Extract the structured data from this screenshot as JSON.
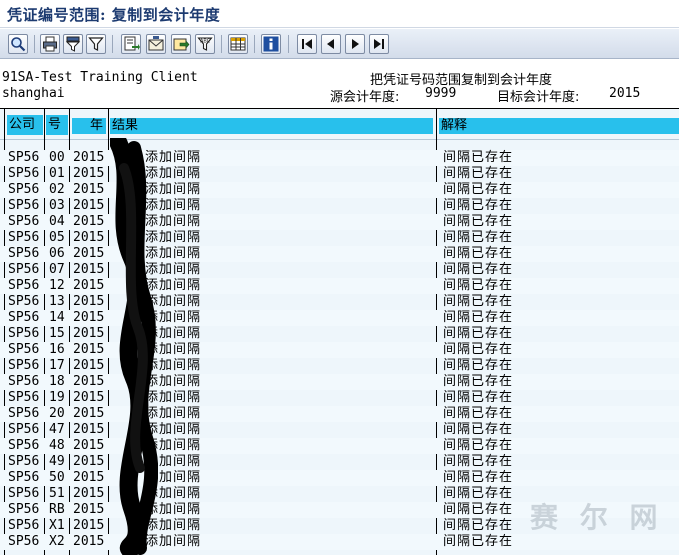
{
  "window": {
    "title": "凭证编号范围: 复制到会计年度"
  },
  "toolbar": {
    "buttons": [
      "search-icon",
      "print-icon",
      "filter-icon",
      "funnel-icon",
      "export-icon",
      "mail-icon",
      "save-icon",
      "abc-filter-icon",
      "table-layout-icon",
      "info-icon",
      "first-page-icon",
      "previous-page-icon",
      "next-page-icon",
      "last-page-icon"
    ]
  },
  "header": {
    "client": "91SA-Test Training Client",
    "city": "shanghai",
    "report_title": "把凭证号码范围复制到会计年度",
    "source_year_label": "源会计年度:",
    "source_year": "9999",
    "target_year_label": "目标会计年度:",
    "target_year": "2015"
  },
  "columns": {
    "company": "公司",
    "number": "号",
    "year": "年",
    "result": "结果",
    "explanation": "解释"
  },
  "rows": [
    {
      "company": "SP56",
      "number": "00",
      "year": "2015",
      "result": "添加间隔",
      "explanation": "间隔已存在"
    },
    {
      "company": "SP56",
      "number": "01",
      "year": "2015",
      "result": "添加间隔",
      "explanation": "间隔已存在"
    },
    {
      "company": "SP56",
      "number": "02",
      "year": "2015",
      "result": "添加间隔",
      "explanation": "间隔已存在"
    },
    {
      "company": "SP56",
      "number": "03",
      "year": "2015",
      "result": "添加间隔",
      "explanation": "间隔已存在"
    },
    {
      "company": "SP56",
      "number": "04",
      "year": "2015",
      "result": "添加间隔",
      "explanation": "间隔已存在"
    },
    {
      "company": "SP56",
      "number": "05",
      "year": "2015",
      "result": "添加间隔",
      "explanation": "间隔已存在"
    },
    {
      "company": "SP56",
      "number": "06",
      "year": "2015",
      "result": "添加间隔",
      "explanation": "间隔已存在"
    },
    {
      "company": "SP56",
      "number": "07",
      "year": "2015",
      "result": "添加间隔",
      "explanation": "间隔已存在"
    },
    {
      "company": "SP56",
      "number": "12",
      "year": "2015",
      "result": "添加间隔",
      "explanation": "间隔已存在"
    },
    {
      "company": "SP56",
      "number": "13",
      "year": "2015",
      "result": "添加间隔",
      "explanation": "间隔已存在"
    },
    {
      "company": "SP56",
      "number": "14",
      "year": "2015",
      "result": "添加间隔",
      "explanation": "间隔已存在"
    },
    {
      "company": "SP56",
      "number": "15",
      "year": "2015",
      "result": "添加间隔",
      "explanation": "间隔已存在"
    },
    {
      "company": "SP56",
      "number": "16",
      "year": "2015",
      "result": "添加间隔",
      "explanation": "间隔已存在"
    },
    {
      "company": "SP56",
      "number": "17",
      "year": "2015",
      "result": "添加间隔",
      "explanation": "间隔已存在"
    },
    {
      "company": "SP56",
      "number": "18",
      "year": "2015",
      "result": "添加间隔",
      "explanation": "间隔已存在"
    },
    {
      "company": "SP56",
      "number": "19",
      "year": "2015",
      "result": "添加间隔",
      "explanation": "间隔已存在"
    },
    {
      "company": "SP56",
      "number": "20",
      "year": "2015",
      "result": "添加间隔",
      "explanation": "间隔已存在"
    },
    {
      "company": "SP56",
      "number": "47",
      "year": "2015",
      "result": "添加间隔",
      "explanation": "间隔已存在"
    },
    {
      "company": "SP56",
      "number": "48",
      "year": "2015",
      "result": "添加间隔",
      "explanation": "间隔已存在"
    },
    {
      "company": "SP56",
      "number": "49",
      "year": "2015",
      "result": "添加间隔",
      "explanation": "间隔已存在"
    },
    {
      "company": "SP56",
      "number": "50",
      "year": "2015",
      "result": "添加间隔",
      "explanation": "间隔已存在"
    },
    {
      "company": "SP56",
      "number": "51",
      "year": "2015",
      "result": "添加间隔",
      "explanation": "间隔已存在"
    },
    {
      "company": "SP56",
      "number": "RB",
      "year": "2015",
      "result": "添加间隔",
      "explanation": "间隔已存在"
    },
    {
      "company": "SP56",
      "number": "X1",
      "year": "2015",
      "result": "添加间隔",
      "explanation": "间隔已存在"
    },
    {
      "company": "SP56",
      "number": "X2",
      "year": "2015",
      "result": "添加间隔",
      "explanation": "间隔已存在"
    }
  ],
  "watermark": "赛 尔 网"
}
